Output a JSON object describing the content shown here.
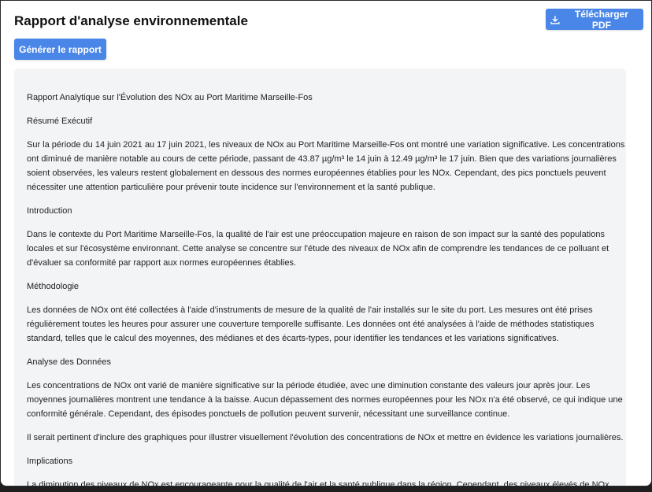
{
  "header": {
    "title": "Rapport d'analyse environnementale",
    "download_label": "Télécharger PDF",
    "download_icon": "download-icon",
    "generate_label": "Générer le rapport"
  },
  "colors": {
    "accent": "#4a86e8",
    "report_bg": "#f3f4f6"
  },
  "report": {
    "paragraphs": [
      "Rapport Analytique sur l'Évolution des NOx au Port Maritime Marseille-Fos",
      "Résumé Exécutif",
      "Sur la période du 14 juin 2021 au 17 juin 2021, les niveaux de NOx au Port Maritime Marseille-Fos ont montré une variation significative. Les concentrations ont diminué de manière notable au cours de cette période, passant de 43.87 µg/m³ le 14 juin à 12.49 µg/m³ le 17 juin. Bien que des variations journalières soient observées, les valeurs restent globalement en dessous des normes européennes établies pour les NOx. Cependant, des pics ponctuels peuvent nécessiter une attention particulière pour prévenir toute incidence sur l'environnement et la santé publique.",
      "Introduction",
      "Dans le contexte du Port Maritime Marseille-Fos, la qualité de l'air est une préoccupation majeure en raison de son impact sur la santé des populations locales et sur l'écosystème environnant. Cette analyse se concentre sur l'étude des niveaux de NOx afin de comprendre les tendances de ce polluant et d'évaluer sa conformité par rapport aux normes européennes établies.",
      "Méthodologie",
      "Les données de NOx ont été collectées à l'aide d'instruments de mesure de la qualité de l'air installés sur le site du port. Les mesures ont été prises régulièrement toutes les heures pour assurer une couverture temporelle suffisante. Les données ont été analysées à l'aide de méthodes statistiques standard, telles que le calcul des moyennes, des médianes et des écarts-types, pour identifier les tendances et les variations significatives.",
      "Analyse des Données",
      "Les concentrations de NOx ont varié de manière significative sur la période étudiée, avec une diminution constante des valeurs jour après jour. Les moyennes journalières montrent une tendance à la baisse. Aucun dépassement des normes européennes pour les NOx n'a été observé, ce qui indique une conformité générale. Cependant, des épisodes ponctuels de pollution peuvent survenir, nécessitant une surveillance continue.",
      "Il serait pertinent d'inclure des graphiques pour illustrer visuellement l'évolution des concentrations de NOx et mettre en évidence les variations journalières.",
      "Implications",
      "La diminution des niveaux de NOx est encourageante pour la qualité de l'air et la santé publique dans la région. Cependant, des niveaux élevés de NOx peuvent avoir des effets néfastes sur la santé respiratoire des populations exposées. Il est essentiel de maintenir une surveillance régulière et d'adopter des"
    ]
  }
}
